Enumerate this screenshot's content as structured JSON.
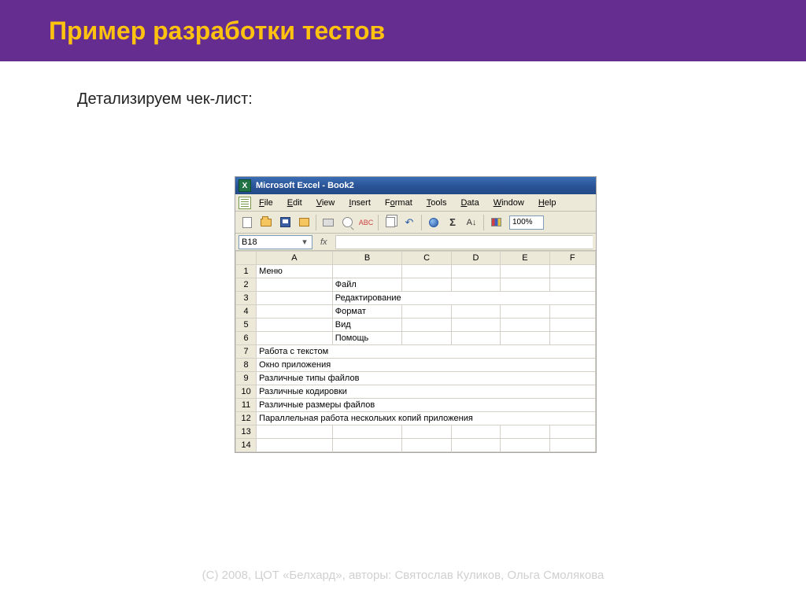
{
  "slide": {
    "title": "Пример разработки тестов",
    "subtitle": "Детализируем чек-лист:",
    "footer": "(С) 2008, ЦОТ «Белхард», авторы: Святослав Куликов, Ольга Смолякова"
  },
  "excel": {
    "titlebar": "Microsoft Excel - Book2",
    "menu": {
      "file": "File",
      "edit": "Edit",
      "view": "View",
      "insert": "Insert",
      "format": "Format",
      "tools": "Tools",
      "data": "Data",
      "window": "Window",
      "help": "Help"
    },
    "zoom": "100%",
    "namebox": "B18",
    "fx_label": "fx",
    "columns": [
      "A",
      "B",
      "C",
      "D",
      "E",
      "F"
    ],
    "rows": [
      {
        "n": "1",
        "a": "Меню",
        "b": ""
      },
      {
        "n": "2",
        "a": "",
        "b": "Файл"
      },
      {
        "n": "3",
        "a": "",
        "b": "Редактирование"
      },
      {
        "n": "4",
        "a": "",
        "b": "Формат"
      },
      {
        "n": "5",
        "a": "",
        "b": "Вид"
      },
      {
        "n": "6",
        "a": "",
        "b": "Помощь"
      },
      {
        "n": "7",
        "a": "Работа с текстом",
        "b": ""
      },
      {
        "n": "8",
        "a": "Окно приложения",
        "b": ""
      },
      {
        "n": "9",
        "a": "Различные типы файлов",
        "b": ""
      },
      {
        "n": "10",
        "a": "Различные кодировки",
        "b": ""
      },
      {
        "n": "11",
        "a": "Различные размеры файлов",
        "b": ""
      },
      {
        "n": "12",
        "a": "Параллельная работа нескольких копий приложения",
        "b": ""
      },
      {
        "n": "13",
        "a": "",
        "b": ""
      },
      {
        "n": "14",
        "a": "",
        "b": ""
      }
    ]
  }
}
